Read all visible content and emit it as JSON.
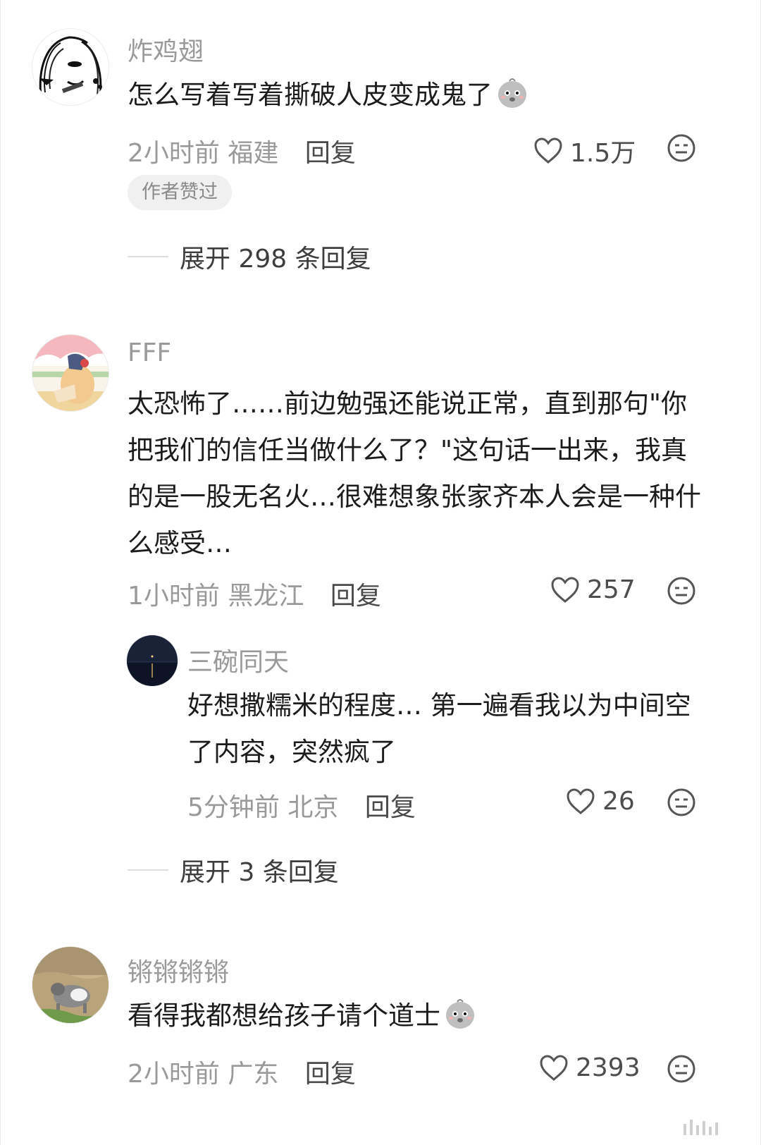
{
  "comments": [
    {
      "username": "炸鸡翅",
      "text": "怎么写着写着撕破人皮变成鬼了",
      "emoji": "chick-emoji",
      "time": "2小时前",
      "location": "福建",
      "reply_label": "回复",
      "likes": "1.5万",
      "badge": "作者赞过",
      "expand_text": "展开 298 条回复"
    },
    {
      "username": "FFF",
      "text": "太恐怖了……前边勉强还能说正常，直到那句\"你把我们的信任当做什么了？\"这句话一出来，我真的是一股无名火…很难想象张家齐本人会是一种什么感受…",
      "time": "1小时前",
      "location": "黑龙江",
      "reply_label": "回复",
      "likes": "257",
      "sub_reply": {
        "username": "三碗同天",
        "text": "好想撒糯米的程度… 第一遍看我以为中间空了内容，突然疯了",
        "time": "5分钟前",
        "location": "北京",
        "reply_label": "回复",
        "likes": "26"
      },
      "expand_text": "展开 3 条回复"
    },
    {
      "username": "锵锵锵锵",
      "text": "看得我都想给孩子请个道士",
      "emoji": "chick-emoji",
      "time": "2小时前",
      "location": "广东",
      "reply_label": "回复",
      "likes": "2393"
    }
  ],
  "colors": {
    "meta": "#9a9a9a",
    "text": "#1c1c1c",
    "badge_bg": "#f0f0f0"
  }
}
